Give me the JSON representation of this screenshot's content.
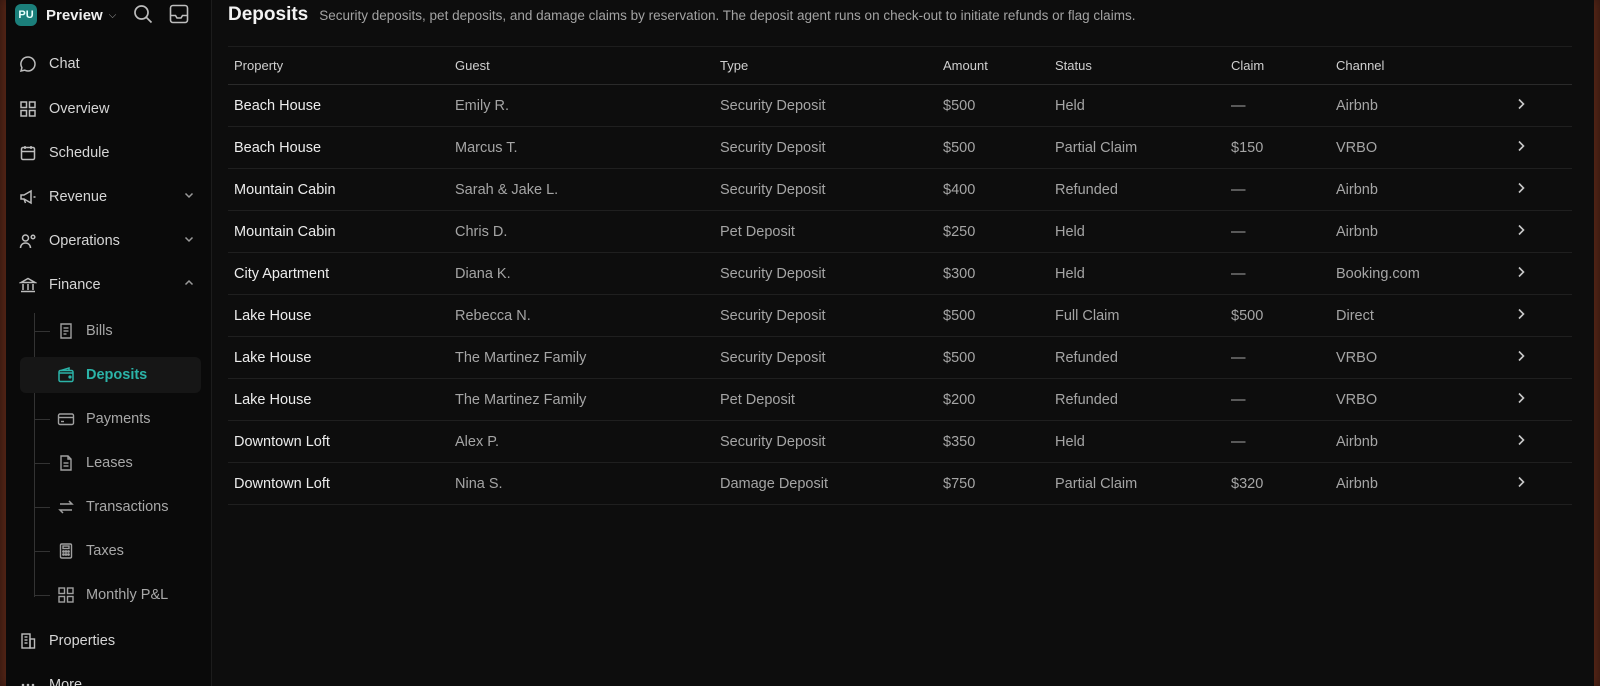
{
  "sidebar": {
    "workspace": {
      "initials": "PU",
      "name": "Preview"
    },
    "top_icons": [
      "search-icon",
      "inbox-icon"
    ],
    "items": [
      {
        "label": "Chat",
        "icon": "chat-icon"
      },
      {
        "label": "Overview",
        "icon": "grid-icon"
      },
      {
        "label": "Schedule",
        "icon": "calendar-icon"
      },
      {
        "label": "Revenue",
        "icon": "megaphone-icon",
        "expanded": false
      },
      {
        "label": "Operations",
        "icon": "people-gear-icon",
        "expanded": false
      },
      {
        "label": "Finance",
        "icon": "bank-icon",
        "expanded": true
      }
    ],
    "finance_items": [
      {
        "label": "Bills",
        "icon": "receipt-icon"
      },
      {
        "label": "Deposits",
        "icon": "wallet-icon",
        "active": true
      },
      {
        "label": "Payments",
        "icon": "credit-card-icon"
      },
      {
        "label": "Leases",
        "icon": "document-icon"
      },
      {
        "label": "Transactions",
        "icon": "arrows-exchange-icon"
      },
      {
        "label": "Taxes",
        "icon": "calculator-icon"
      },
      {
        "label": "Monthly P&L",
        "icon": "grid-icon"
      }
    ],
    "bottom_items": [
      {
        "label": "Properties",
        "icon": "building-icon"
      },
      {
        "label": "More",
        "icon": "more-icon"
      }
    ]
  },
  "page": {
    "title": "Deposits",
    "description": "Security deposits, pet deposits, and damage claims by reservation. The deposit agent runs on check-out to initiate refunds or flag claims."
  },
  "table": {
    "columns": [
      "Property",
      "Guest",
      "Type",
      "Amount",
      "Status",
      "Claim",
      "Channel"
    ],
    "rows": [
      [
        "Beach House",
        "Emily R.",
        "Security Deposit",
        "$500",
        "Held",
        "—",
        "Airbnb"
      ],
      [
        "Beach House",
        "Marcus T.",
        "Security Deposit",
        "$500",
        "Partial Claim",
        "$150",
        "VRBO"
      ],
      [
        "Mountain Cabin",
        "Sarah & Jake L.",
        "Security Deposit",
        "$400",
        "Refunded",
        "—",
        "Airbnb"
      ],
      [
        "Mountain Cabin",
        "Chris D.",
        "Pet Deposit",
        "$250",
        "Held",
        "—",
        "Airbnb"
      ],
      [
        "City Apartment",
        "Diana K.",
        "Security Deposit",
        "$300",
        "Held",
        "—",
        "Booking.com"
      ],
      [
        "Lake House",
        "Rebecca N.",
        "Security Deposit",
        "$500",
        "Full Claim",
        "$500",
        "Direct"
      ],
      [
        "Lake House",
        "The Martinez Family",
        "Security Deposit",
        "$500",
        "Refunded",
        "—",
        "VRBO"
      ],
      [
        "Lake House",
        "The Martinez Family",
        "Pet Deposit",
        "$200",
        "Refunded",
        "—",
        "VRBO"
      ],
      [
        "Downtown Loft",
        "Alex P.",
        "Security Deposit",
        "$350",
        "Held",
        "—",
        "Airbnb"
      ],
      [
        "Downtown Loft",
        "Nina S.",
        "Damage Deposit",
        "$750",
        "Partial Claim",
        "$320",
        "Airbnb"
      ]
    ]
  },
  "colors": {
    "accent": "#2bb3a8",
    "background": "#0d0d0d",
    "frame_glow": "#8c3c1e"
  }
}
